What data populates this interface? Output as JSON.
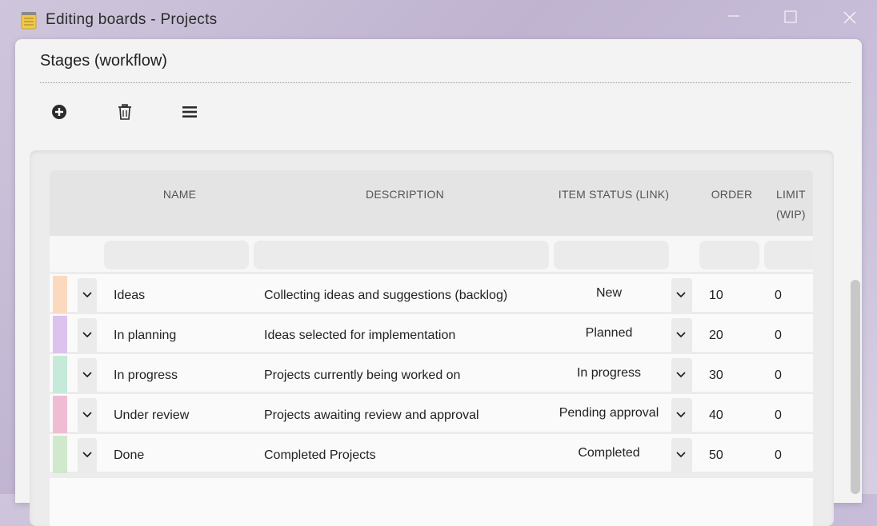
{
  "window": {
    "title": "Editing boards - Projects"
  },
  "section": {
    "title": "Stages (workflow)"
  },
  "toolbar": [
    {
      "icon": "add-circle-icon"
    },
    {
      "icon": "trash-icon"
    },
    {
      "icon": "menu-icon"
    }
  ],
  "grid": {
    "columns": [
      "NAME",
      "DESCRIPTION",
      "ITEM STATUS (LINK)",
      "ORDER",
      "LIMIT (WIP)"
    ],
    "rows": [
      {
        "color": "#fbd9bf",
        "name": "Ideas",
        "description": "Collecting ideas and suggestions (backlog)",
        "status": "New",
        "order": "10",
        "limit": "0"
      },
      {
        "color": "#dcc3ee",
        "name": "In planning",
        "description": "Ideas selected for implementation",
        "status": "Planned",
        "order": "20",
        "limit": "0"
      },
      {
        "color": "#c6ead9",
        "name": "In progress",
        "description": "Projects currently being worked on",
        "status": "In progress",
        "order": "30",
        "limit": "0"
      },
      {
        "color": "#efbdd3",
        "name": "Under review",
        "description": "Projects awaiting review and approval",
        "status": "Pending approval",
        "order": "40",
        "limit": "0"
      },
      {
        "color": "#d0e8cc",
        "name": "Done",
        "description": "Completed Projects",
        "status": "Completed",
        "order": "50",
        "limit": "0"
      }
    ]
  },
  "colors": {
    "accent_icon": "#2b2b2b",
    "header_bg": "#e4e4e4",
    "dialog_bg": "#f3f3f3"
  }
}
